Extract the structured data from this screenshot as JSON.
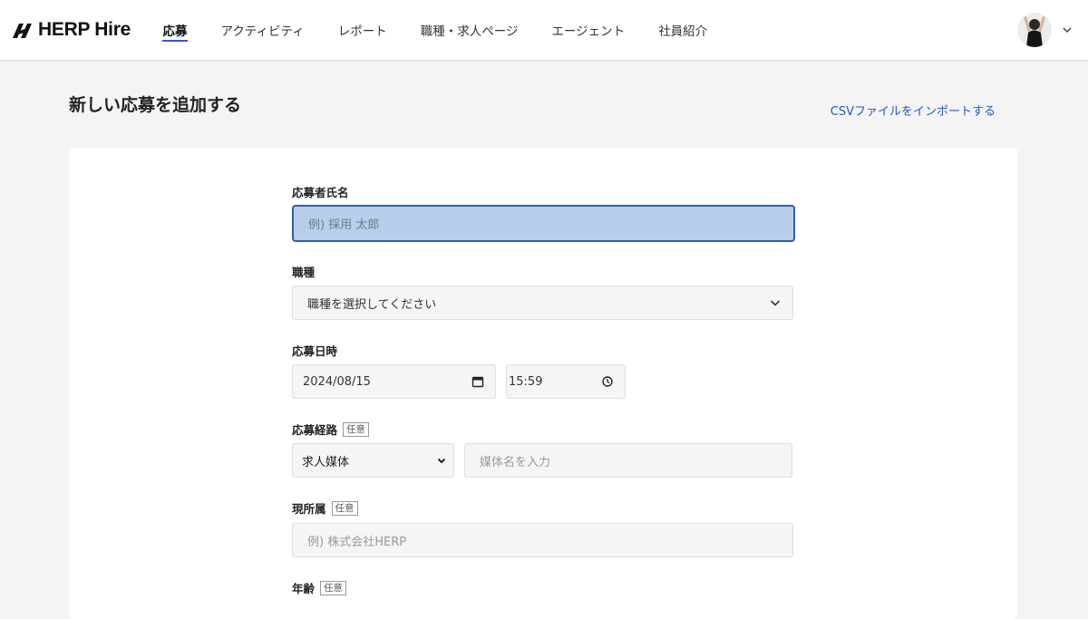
{
  "app": {
    "brand": "HERP Hire"
  },
  "nav": {
    "items": [
      {
        "label": "応募",
        "active": true
      },
      {
        "label": "アクティビティ",
        "active": false
      },
      {
        "label": "レポート",
        "active": false
      },
      {
        "label": "職種・求人ページ",
        "active": false
      },
      {
        "label": "エージェント",
        "active": false
      },
      {
        "label": "社員紹介",
        "active": false
      }
    ]
  },
  "page": {
    "title": "新しい応募を追加する",
    "csv_import_link": "CSVファイルをインポートする"
  },
  "form": {
    "applicant_name": {
      "label": "応募者氏名",
      "placeholder": "例) 採用 太郎",
      "value": ""
    },
    "position": {
      "label": "職種",
      "selected": "職種を選択してください"
    },
    "applied_at": {
      "label": "応募日時",
      "date": "2024/08/15",
      "time": "15:59"
    },
    "channel": {
      "label": "応募経路",
      "optional_badge": "任意",
      "selected": "求人媒体",
      "media_placeholder": "媒体名を入力"
    },
    "current_company": {
      "label": "現所属",
      "optional_badge": "任意",
      "placeholder": "例) 株式会社HERP"
    },
    "age": {
      "label": "年齢",
      "optional_badge": "任意"
    }
  },
  "colors": {
    "accent": "#2a5cc7",
    "link": "#2458c6",
    "focus_bg": "#b7cfeb",
    "focus_border": "#2d5fae"
  }
}
